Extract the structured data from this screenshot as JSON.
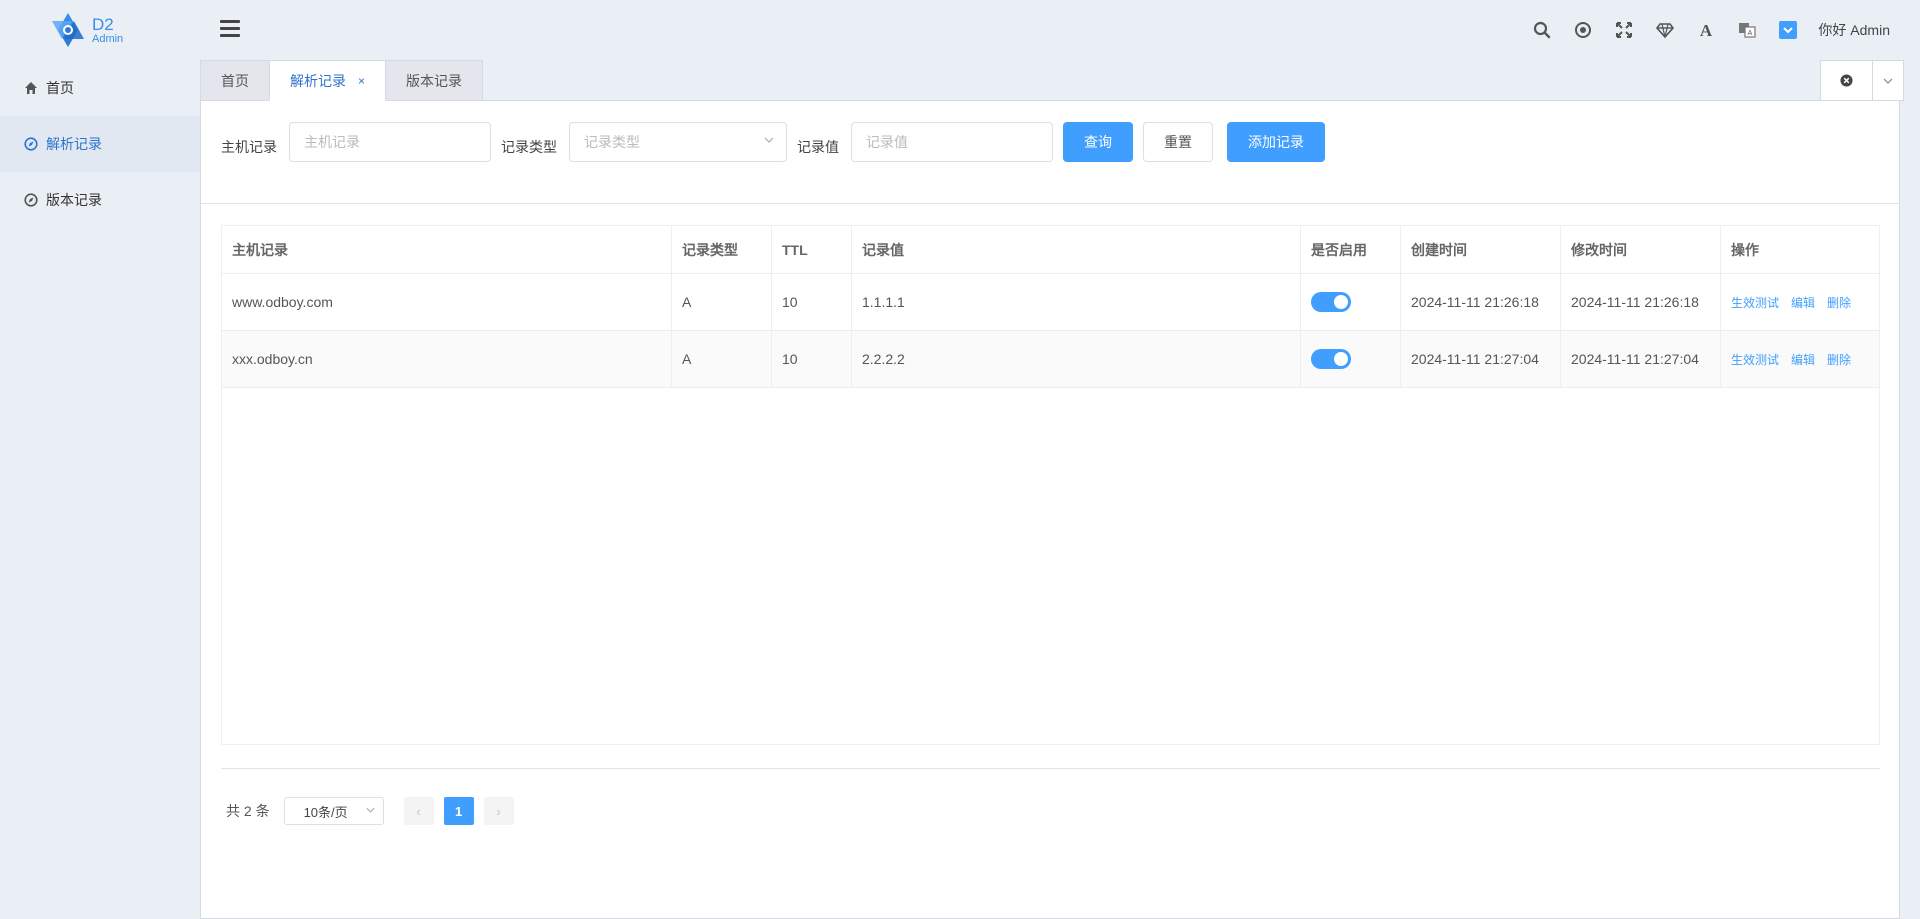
{
  "brand": {
    "name": "D2",
    "sub": "Admin",
    "color": "#3a8ee6"
  },
  "header": {
    "greeting": "你好 Admin",
    "icons": [
      "search-icon",
      "target-icon",
      "fullscreen-icon",
      "diamond-icon",
      "font-icon",
      "translate-icon",
      "theme-icon"
    ]
  },
  "sidebar": {
    "items": [
      {
        "label": "首页",
        "icon": "home-icon"
      },
      {
        "label": "解析记录",
        "icon": "compass-icon"
      },
      {
        "label": "版本记录",
        "icon": "compass-icon"
      }
    ]
  },
  "tabs": [
    {
      "label": "首页"
    },
    {
      "label": "解析记录",
      "close": "×"
    },
    {
      "label": "版本记录"
    }
  ],
  "search": {
    "host_label": "主机记录",
    "host_placeholder": "主机记录",
    "type_label": "记录类型",
    "type_placeholder": "记录类型",
    "value_label": "记录值",
    "value_placeholder": "记录值",
    "query_btn": "查询",
    "reset_btn": "重置",
    "add_btn": "添加记录"
  },
  "table": {
    "columns": [
      "主机记录",
      "记录类型",
      "TTL",
      "记录值",
      "是否启用",
      "创建时间",
      "修改时间",
      "操作"
    ],
    "rows": [
      {
        "host": "www.odboy.com",
        "type": "A",
        "ttl": "10",
        "value": "1.1.1.1",
        "enabled": true,
        "created": "2024-11-11 21:26:18",
        "modified": "2024-11-11 21:26:18"
      },
      {
        "host": "xxx.odboy.cn",
        "type": "A",
        "ttl": "10",
        "value": "2.2.2.2",
        "enabled": true,
        "created": "2024-11-11 21:27:04",
        "modified": "2024-11-11 21:27:04"
      }
    ],
    "actions": {
      "test": "生效测试",
      "edit": "编辑",
      "delete": "删除"
    }
  },
  "pagination": {
    "total": "共 2 条",
    "page_size": "10条/页",
    "current": "1",
    "prev": "‹",
    "next": "›"
  },
  "colors": {
    "accent": "#409eff",
    "active_text": "#2f74d0",
    "background": "#eaeef5"
  }
}
